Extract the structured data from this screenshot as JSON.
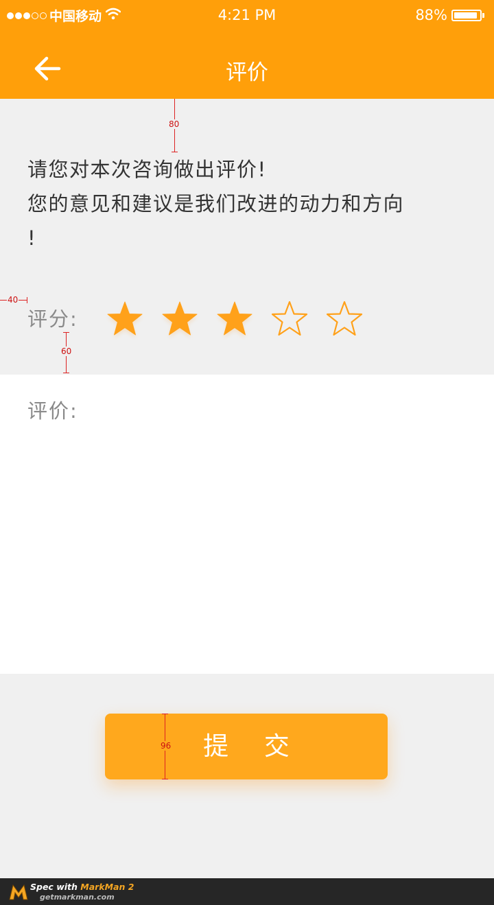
{
  "status_bar": {
    "carrier": "中国移动",
    "time": "4:21 PM",
    "battery": "88%",
    "battery_level": 0.88,
    "signal_filled": 3,
    "signal_total": 5
  },
  "nav": {
    "title": "评价",
    "back_icon": "arrow-left-icon"
  },
  "prompt": {
    "line1": "请您对本次咨询做出评价!",
    "line2": "您的意见和建议是我们改进的动力和方向",
    "line3": "!"
  },
  "rating": {
    "label": "评分:",
    "value": 3,
    "max": 5
  },
  "comment": {
    "label": "评价:",
    "value": ""
  },
  "submit_label": "提 交",
  "spec_marks": {
    "top_gap": "80",
    "left_margin": "40",
    "rating_gap": "60",
    "button_height": "96"
  },
  "footer": {
    "spec_prefix": "Spec with ",
    "product": "MarkMan 2",
    "url": "getmarkman.com"
  },
  "colors": {
    "primary": "#ff9f0a",
    "button": "#ffa81d",
    "star": "#ffa11a",
    "spec_mark": "#dd2222"
  }
}
